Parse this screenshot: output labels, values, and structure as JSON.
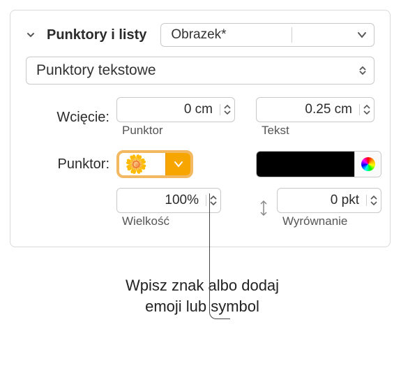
{
  "section_title": "Punktory i listy",
  "top_select_value": "Obrazek*",
  "list_type_value": "Punktory tekstowe",
  "indent": {
    "label": "Wcięcie:",
    "punktor_value": "0 cm",
    "punktor_sublabel": "Punktor",
    "tekst_value": "0.25 cm",
    "tekst_sublabel": "Tekst"
  },
  "bullet": {
    "label": "Punktor:",
    "emoji": "🌼",
    "color": "#000000"
  },
  "size": {
    "value": "100%",
    "sublabel": "Wielkość"
  },
  "align": {
    "value": "0 pkt",
    "sublabel": "Wyrównanie"
  },
  "caption_line1": "Wpisz znak albo dodaj",
  "caption_line2": "emoji lub symbol"
}
